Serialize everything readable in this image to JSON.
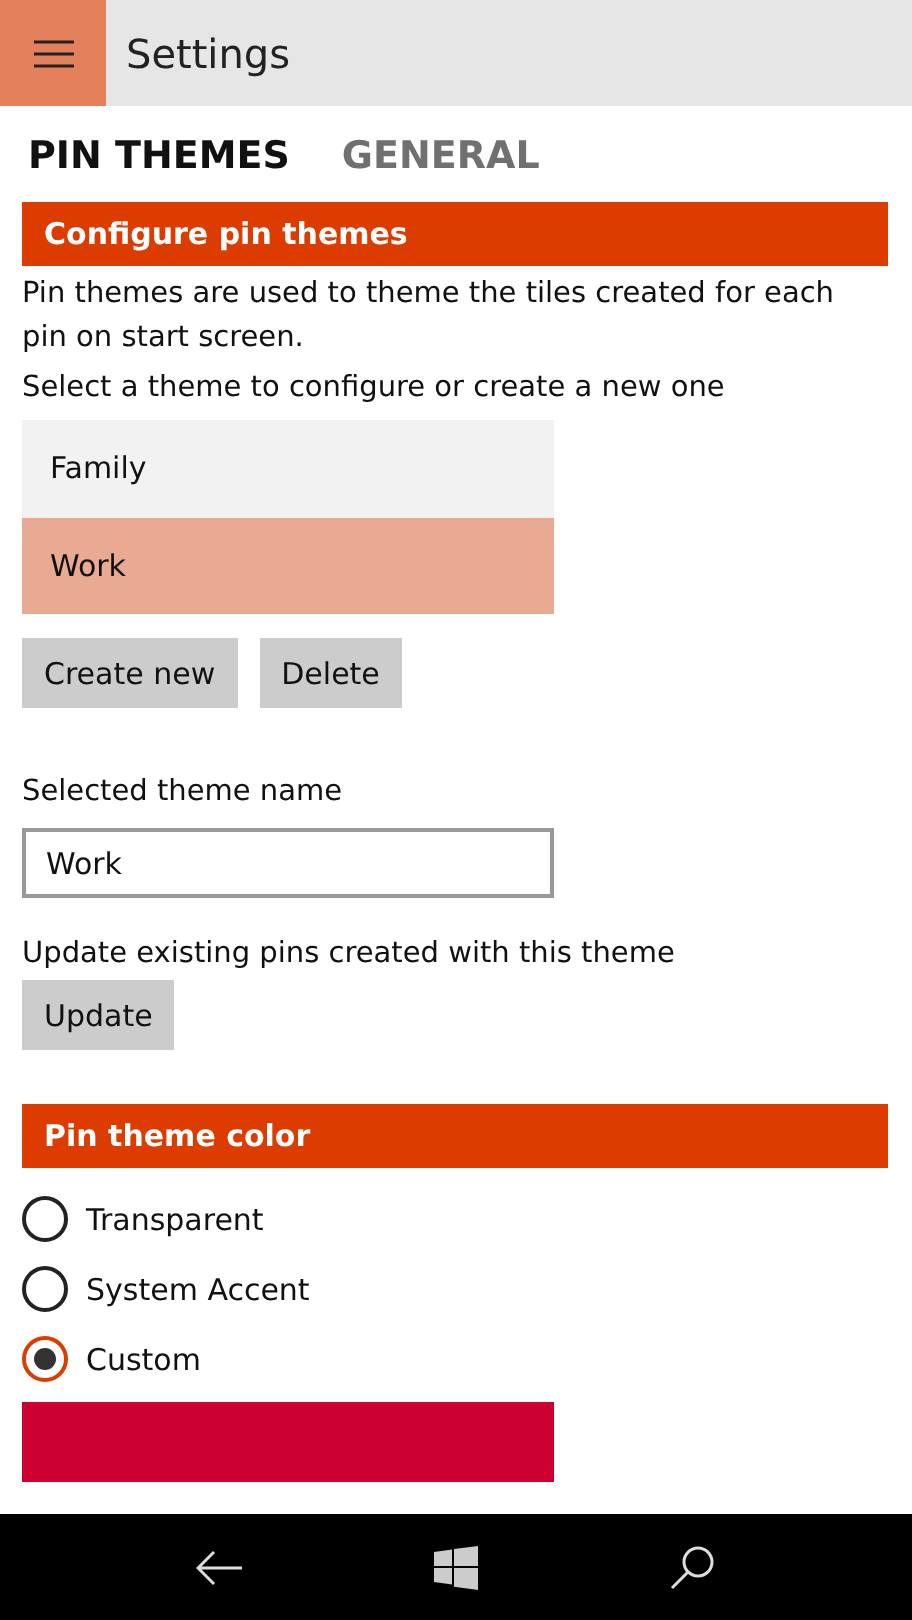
{
  "header": {
    "title": "Settings"
  },
  "tabs": [
    {
      "label": "PIN THEMES",
      "selected": true
    },
    {
      "label": "GENERAL",
      "selected": false
    }
  ],
  "configure_section": {
    "title": "Configure pin themes",
    "description": "Pin themes are used to theme the tiles created for each pin on start screen.",
    "prompt": "Select a theme to configure or create a new one",
    "themes": [
      {
        "label": "Family",
        "selected": false
      },
      {
        "label": "Work",
        "selected": true
      }
    ],
    "buttons": [
      "Create new",
      "Delete"
    ],
    "name_label": "Selected theme name",
    "name_value": "Work",
    "update_label": "Update existing pins created with this theme",
    "update_button": "Update"
  },
  "color_section": {
    "title": "Pin theme color",
    "options": [
      {
        "label": "Transparent",
        "selected": false
      },
      {
        "label": "System Accent",
        "selected": false
      },
      {
        "label": "Custom",
        "selected": true
      }
    ]
  }
}
